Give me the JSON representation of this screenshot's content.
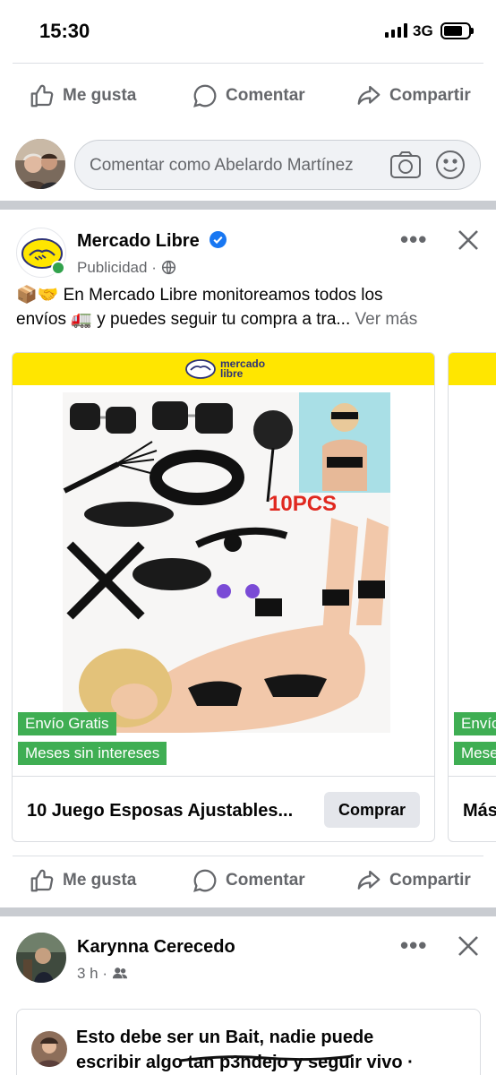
{
  "status_bar": {
    "time": "15:30",
    "network": "3G"
  },
  "actions": {
    "like": "Me gusta",
    "comment": "Comentar",
    "share": "Compartir"
  },
  "comment_box": {
    "placeholder": "Comentar como Abelardo Martínez"
  },
  "ad_post": {
    "page_name": "Mercado Libre",
    "subtitle": "Publicidad",
    "text_line1": "📦🤝 En Mercado Libre monitoreamos todos los",
    "text_line2": "envíos 🚛 y puedes seguir tu compra a tra...",
    "see_more": "Ver más",
    "card": {
      "brand_word1": "mercado",
      "brand_word2": "libre",
      "image_overlay_text": "10PCS",
      "badge_shipping": "Envío Gratis",
      "badge_installments": "Meses sin intereses",
      "product_title": "10 Juego Esposas Ajustables...",
      "buy_button": "Comprar"
    },
    "card2": {
      "badge_shipping": "Envío Gratis",
      "badge_installments": "Meses sin intereses",
      "product_title": "Más"
    }
  },
  "next_post": {
    "author": "Karynna Cerecedo",
    "time": "3 h",
    "reply_text_line1": "Esto debe ser un Bait, nadie puede",
    "reply_text_line2": "escribir algo tan p3ndejo y seguir vivo ·"
  },
  "colors": {
    "ml_yellow": "#ffe600",
    "badge_green": "#3fae53",
    "verified_blue": "#1877f2",
    "online_green": "#31a24c"
  }
}
